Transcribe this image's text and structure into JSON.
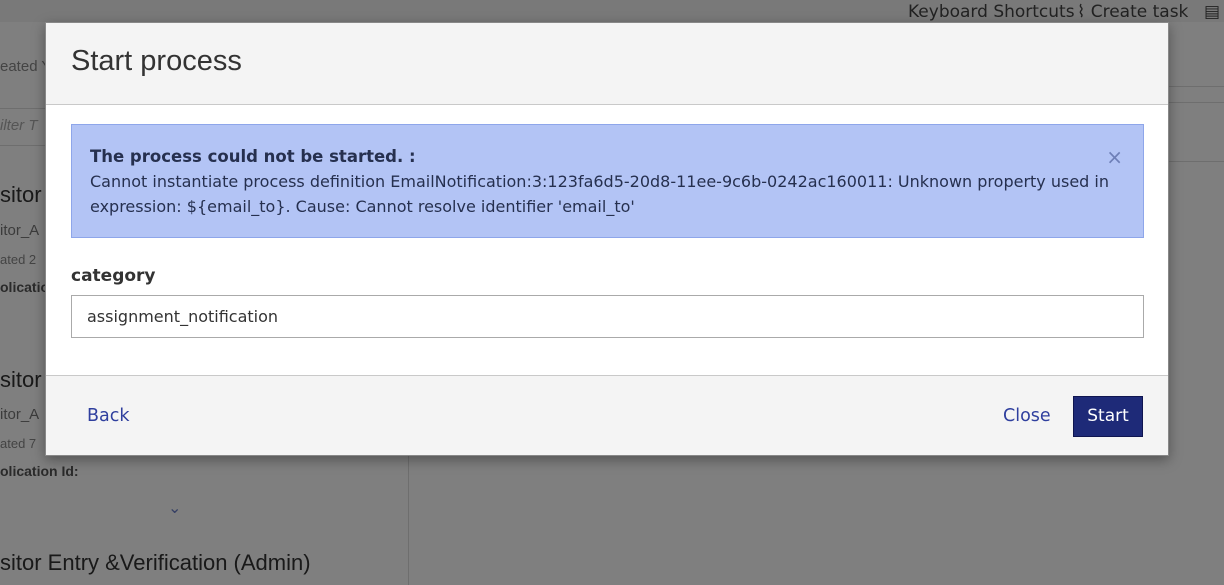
{
  "background": {
    "top_links": [
      "Keyboard Shortcuts",
      "Create task"
    ],
    "left_rows": {
      "created_text": "eated Y",
      "filter_placeholder": "ilter T",
      "item1_title": "sitor",
      "item1_sub": "itor_A",
      "item1_date": "ated 2",
      "item1_label": "olication",
      "item2_title": "sitor",
      "item2_sub": "itor_A",
      "item2_date": "ated 7",
      "item2_label": "olication Id:",
      "item3_title": "sitor Entry &Verification (Admin)"
    }
  },
  "modal": {
    "title": "Start process",
    "alert": {
      "title": "The process could not be started. :",
      "message": "Cannot instantiate process definition EmailNotification:3:123fa6d5-20d8-11ee-9c6b-0242ac160011: Unknown property used in expression: ${email_to}. Cause: Cannot resolve identifier 'email_to'",
      "close_symbol": "×"
    },
    "field": {
      "label": "category",
      "value": "assignment_notification"
    },
    "footer": {
      "back_label": "Back",
      "close_label": "Close",
      "start_label": "Start"
    }
  },
  "colors": {
    "alert_bg": "#b3c4f5",
    "primary": "#1e2a78",
    "link": "#2f3f9e"
  }
}
